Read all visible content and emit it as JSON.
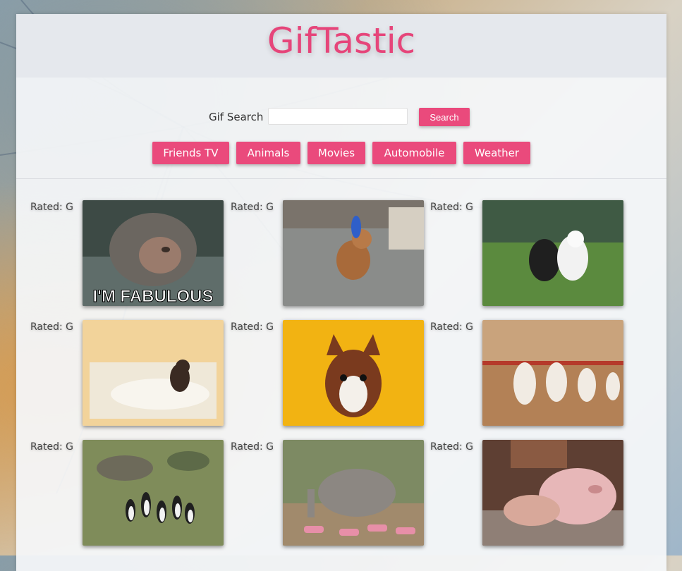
{
  "app": {
    "title": "GifTastic"
  },
  "search": {
    "label": "Gif Search",
    "value": "",
    "placeholder": "",
    "button_label": "Search"
  },
  "topics": [
    "Friends TV",
    "Animals",
    "Movies",
    "Automobile",
    "Weather"
  ],
  "gifs": [
    {
      "rating": "Rated: G",
      "caption": "I'M FABULOUS",
      "subject": "monkey-in-hot-spring"
    },
    {
      "rating": "Rated: G",
      "subject": "dog-with-blue-toy"
    },
    {
      "rating": "Rated: G",
      "subject": "two-dogs-in-field"
    },
    {
      "rating": "Rated: G",
      "subject": "monkey-in-bathtub"
    },
    {
      "rating": "Rated: G",
      "subject": "boston-terrier-yellow"
    },
    {
      "rating": "Rated: G",
      "subject": "dancing-poodles"
    },
    {
      "rating": "Rated: G",
      "subject": "penguins-walking"
    },
    {
      "rating": "Rated: G",
      "subject": "elephant-in-sneakers"
    },
    {
      "rating": "Rated: G",
      "subject": "pig-with-girl"
    }
  ],
  "colors": {
    "accent": "#ea4a7c",
    "title": "#e6457a"
  }
}
